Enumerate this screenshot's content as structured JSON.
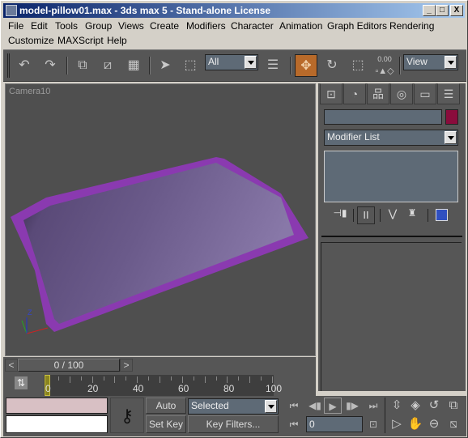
{
  "window": {
    "title": "model-pillow01.max - 3ds max 5 - Stand-alone License",
    "controls": {
      "minimize": "_",
      "maximize": "□",
      "close": "X"
    }
  },
  "menu": {
    "row1": [
      "File",
      "Edit",
      "Tools",
      "Group",
      "Views",
      "Create",
      "Modifiers",
      "Character",
      "Animation",
      "Graph Editors",
      "Rendering"
    ],
    "row2": [
      "Customize",
      "MAXScript",
      "Help"
    ]
  },
  "toolbar": {
    "icons": [
      "undo-icon",
      "redo-icon",
      "link-icon",
      "unlink-icon",
      "bind-space-warp-icon",
      "select-arrow-icon",
      "region-select-icon",
      "select-by-name-icon",
      "move-icon",
      "rotate-icon",
      "scale-icon",
      "spinner-snap-icon"
    ],
    "selection_filter": "All",
    "reference_coord": "View",
    "spinner_value": "0.00",
    "active_tool": "move",
    "accent_color": "#b86a2a"
  },
  "viewport": {
    "label": "Camera10",
    "object": "pillow",
    "object_color": "#6e5a8c",
    "border_color": "#8a3ab0",
    "axis": {
      "x": "#cc2222",
      "y": "#22aa22",
      "z_label": "Z",
      "z": "#2233cc"
    }
  },
  "command_panel": {
    "tabs": [
      "create-tab",
      "modify-tab",
      "hierarchy-tab",
      "motion-tab",
      "display-tab",
      "utilities-tab"
    ],
    "name_field": "",
    "object_color": "#8a0c3c",
    "modifier_list": "Modifier List",
    "stack_tools": [
      "pin-stack-icon",
      "show-end-result-icon",
      "make-unique-icon",
      "remove-modifier-icon",
      "configure-modifier-sets-icon"
    ]
  },
  "timeline": {
    "frame_display": "0 / 100",
    "prev": "<",
    "next": ">",
    "ticks": [
      "0",
      "20",
      "40",
      "60",
      "80",
      "100"
    ],
    "current_frame": 0,
    "total_frames": 100
  },
  "status": {
    "maxscript_top": "",
    "maxscript_bottom": "",
    "auto_key": "Auto Key",
    "set_key": "Set Key",
    "key_mode": "Selected",
    "key_filters": "Key Filters...",
    "frame_field": "0",
    "playback_icons": [
      "go-to-start-icon",
      "previous-frame-icon",
      "play-icon",
      "next-frame-icon",
      "go-to-end-icon",
      "key-mode-toggle-icon",
      "time-config-icon"
    ],
    "nav_icons": [
      "zoom-icon",
      "zoom-all-icon",
      "orbit-icon",
      "zoom-extents-all-icon",
      "fov-icon",
      "pan-icon",
      "arc-rotate-icon",
      "maximize-viewport-icon"
    ]
  }
}
